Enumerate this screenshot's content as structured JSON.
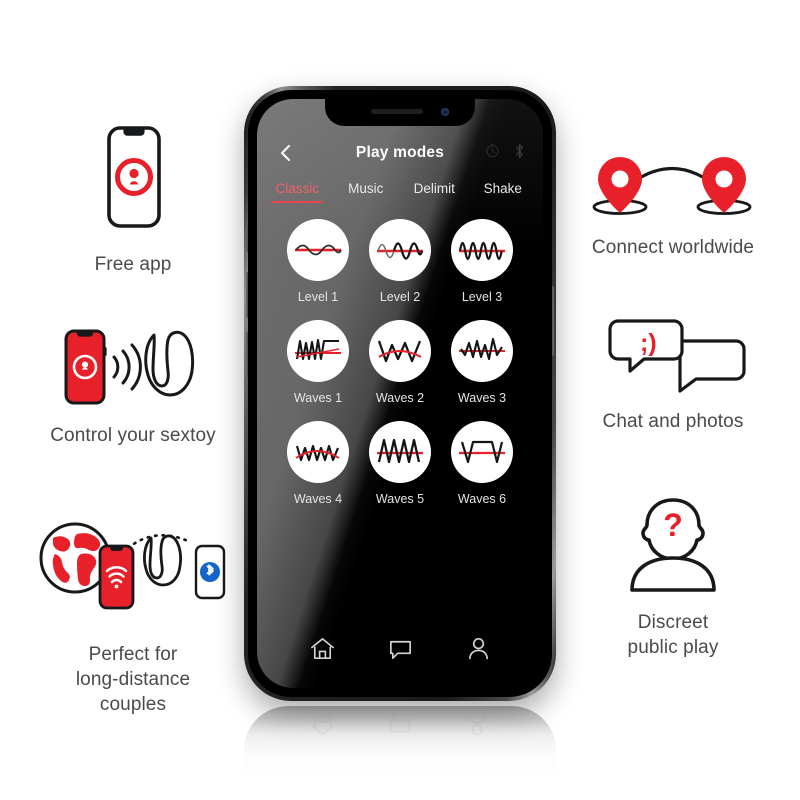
{
  "accent": {
    "red": "#e8202a",
    "tab_active": "#f2606a",
    "screen_dark": "#000000"
  },
  "app": {
    "title": "Play modes",
    "back_icon": "back-chevron-icon",
    "header_icons": [
      "timer-icon",
      "bluetooth-icon"
    ],
    "tabs": [
      {
        "label": "Classic",
        "active": true
      },
      {
        "label": "Music",
        "active": false
      },
      {
        "label": "Delimit",
        "active": false
      },
      {
        "label": "Shake",
        "active": false
      }
    ],
    "modes": [
      {
        "label": "Level 1",
        "wave": "level1"
      },
      {
        "label": "Level 2",
        "wave": "level2"
      },
      {
        "label": "Level 3",
        "wave": "level3"
      },
      {
        "label": "Waves 1",
        "wave": "waves1"
      },
      {
        "label": "Waves 2",
        "wave": "waves2"
      },
      {
        "label": "Waves 3",
        "wave": "waves3"
      },
      {
        "label": "Waves 4",
        "wave": "waves4"
      },
      {
        "label": "Waves 5",
        "wave": "waves5"
      },
      {
        "label": "Waves 6",
        "wave": "waves6"
      }
    ],
    "nav": [
      {
        "icon": "home-icon"
      },
      {
        "icon": "chat-icon"
      },
      {
        "icon": "profile-icon"
      }
    ]
  },
  "features": {
    "free_app": {
      "caption": "Free app",
      "icon": "phone-app-logo-icon"
    },
    "control": {
      "caption": "Control your sextoy",
      "icon": "phone-signal-toy-icon"
    },
    "long_dist": {
      "caption": "Perfect for\nlong-distance\ncouples",
      "icon": "globe-phone-bluetooth-icon",
      "line1": "Perfect for",
      "line2": "long-distance",
      "line3": "couples"
    },
    "worldwide": {
      "caption": "Connect worldwide",
      "icon": "map-pins-arc-icon"
    },
    "chat": {
      "caption": "Chat and photos",
      "icon": "speech-bubbles-wink-icon",
      "emoticon": ";)"
    },
    "discreet": {
      "caption": "Discreet\npublic play",
      "icon": "anonymous-person-icon",
      "line1": "Discreet",
      "line2": "public play"
    }
  }
}
